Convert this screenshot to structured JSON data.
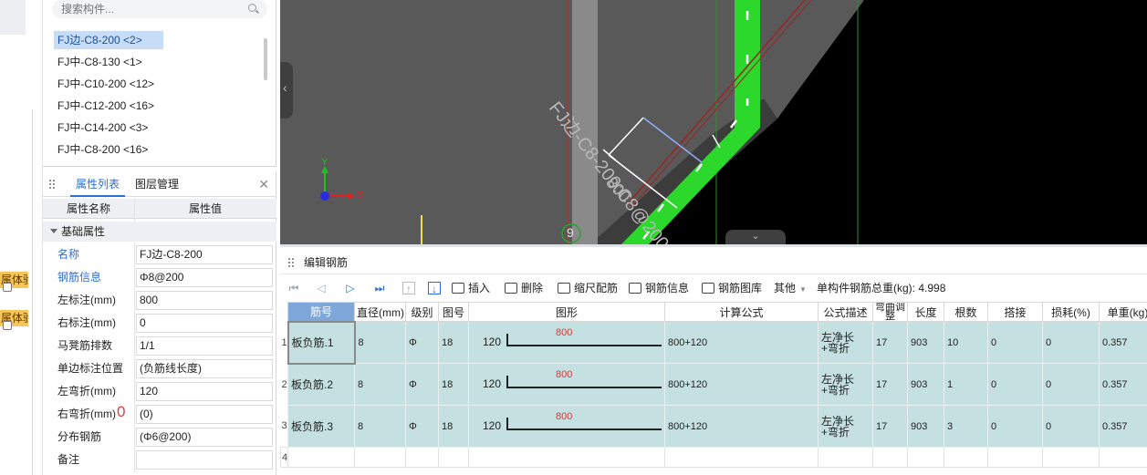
{
  "left_strip": {
    "tags": [
      "属体验",
      "属体验"
    ]
  },
  "component_panel": {
    "search_placeholder": "搜索构件...",
    "items": [
      {
        "label": "FJ边-C8-200 <2>",
        "selected": true
      },
      {
        "label": "FJ中-C8-130 <1>"
      },
      {
        "label": "FJ中-C10-200 <12>"
      },
      {
        "label": "FJ中-C12-200 <16>"
      },
      {
        "label": "FJ中-C14-200 <3>"
      },
      {
        "label": "FJ中-C8-200 <16>"
      }
    ]
  },
  "property_panel": {
    "tabs": [
      "属性列表",
      "图层管理"
    ],
    "columns": [
      "属性名称",
      "属性值"
    ],
    "group": "基础属性",
    "rows": [
      {
        "name": "名称",
        "value": "FJ边-C8-200",
        "highlight": true
      },
      {
        "name": "钢筋信息",
        "value": "Φ8@200",
        "highlight": true
      },
      {
        "name": "左标注(mm)",
        "value": "800"
      },
      {
        "name": "右标注(mm)",
        "value": "0"
      },
      {
        "name": "马凳筋排数",
        "value": "1/1"
      },
      {
        "name": "单边标注位置",
        "value": "(负筋线长度)"
      },
      {
        "name": "左弯折(mm)",
        "value": "120"
      },
      {
        "name": "右弯折(mm)",
        "value": "(0)"
      },
      {
        "name": "分布钢筋",
        "value": "(Φ6@200)"
      },
      {
        "name": "备注",
        "value": ""
      }
    ],
    "annotation": "0"
  },
  "viewport": {
    "rebar_label": "FJ边-C8-200:C8@200",
    "dim_label": "800",
    "axis_label": "9",
    "axis_x": "X",
    "axis_y": "Y"
  },
  "editor": {
    "title": "编辑钢筋",
    "toolbar": {
      "insert": "插入",
      "delete": "删除",
      "scale": "缩尺配筋",
      "info": "钢筋信息",
      "library": "钢筋图库",
      "other": "其他",
      "total_label": "单构件钢筋总重(kg): 4.998"
    },
    "columns": [
      "筋号",
      "直径(mm)",
      "级别",
      "图号",
      "图形",
      "计算公式",
      "公式描述",
      "弯曲调整",
      "长度",
      "根数",
      "搭接",
      "损耗(%)",
      "单重(kg)"
    ],
    "rows": [
      {
        "idx": "1",
        "name": "板负筋.1",
        "diameter": "8",
        "grade": "Φ",
        "fig": "18",
        "left": "120",
        "mid": "800",
        "formula": "800+120",
        "desc": "左净长+弯折",
        "bend": "17",
        "length": "903",
        "count": "10",
        "lap": "0",
        "loss": "0",
        "weight": "0.357"
      },
      {
        "idx": "2",
        "name": "板负筋.2",
        "diameter": "8",
        "grade": "Φ",
        "fig": "18",
        "left": "120",
        "mid": "800",
        "formula": "800+120",
        "desc": "左净长+弯折",
        "bend": "17",
        "length": "903",
        "count": "1",
        "lap": "0",
        "loss": "0",
        "weight": "0.357"
      },
      {
        "idx": "3",
        "name": "板负筋.3",
        "diameter": "8",
        "grade": "Φ",
        "fig": "18",
        "left": "120",
        "mid": "800",
        "formula": "800+120",
        "desc": "左净长+弯折",
        "bend": "17",
        "length": "903",
        "count": "3",
        "lap": "0",
        "loss": "0",
        "weight": "0.357"
      }
    ],
    "empty_row_idx": "4"
  }
}
